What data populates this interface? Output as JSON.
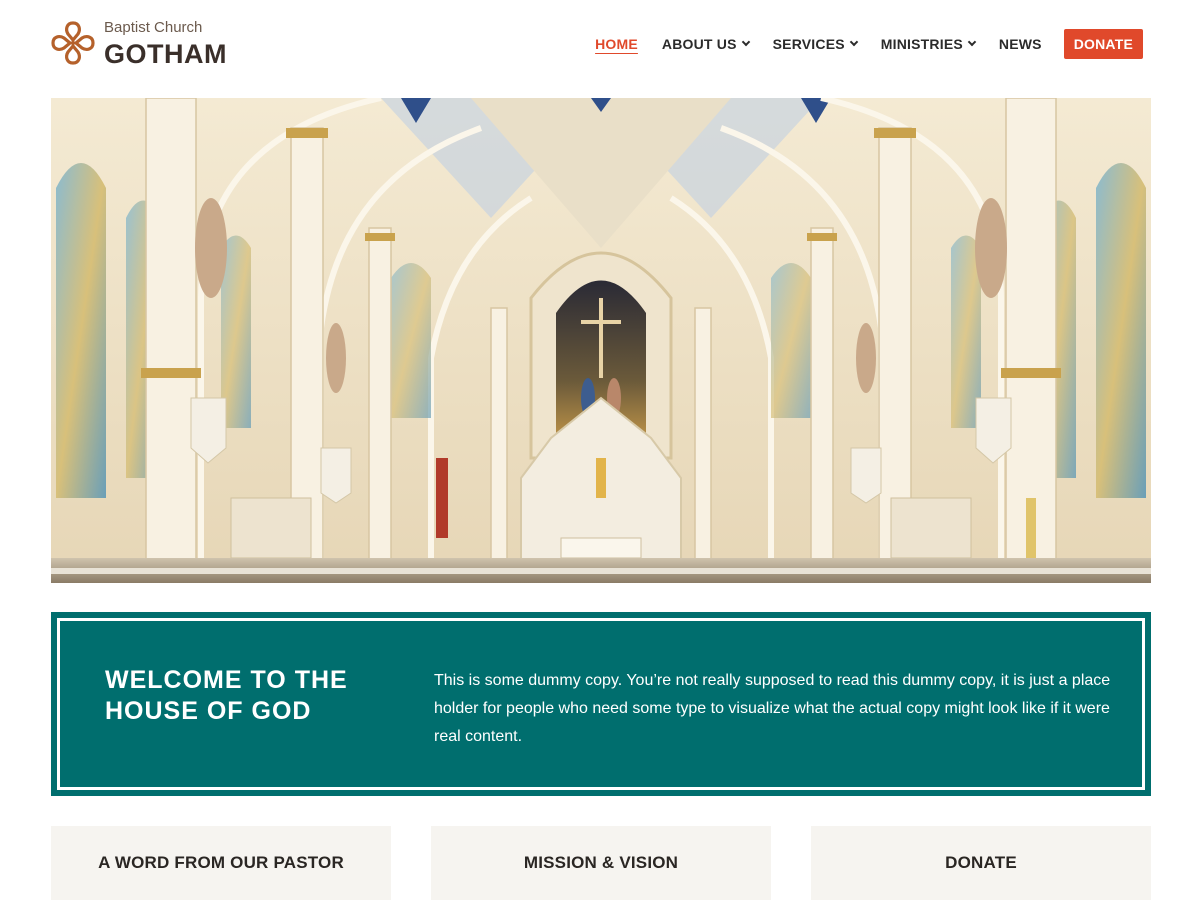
{
  "brand": {
    "subtitle": "Baptist Church",
    "name": "GOTHAM",
    "logo_icon": "cross-flower-icon",
    "logo_color": "#b5612b"
  },
  "nav": {
    "items": [
      {
        "label": "HOME",
        "active": true,
        "has_dropdown": false
      },
      {
        "label": "ABOUT US",
        "active": false,
        "has_dropdown": true
      },
      {
        "label": "SERVICES",
        "active": false,
        "has_dropdown": true
      },
      {
        "label": "MINISTRIES",
        "active": false,
        "has_dropdown": true
      },
      {
        "label": "NEWS",
        "active": false,
        "has_dropdown": false
      }
    ],
    "donate_label": "DONATE"
  },
  "hero": {
    "image": "cathedral-interior-altar-image"
  },
  "welcome": {
    "title": "WELCOME TO THE HOUSE OF GOD",
    "body": "This is some dummy copy. You’re not really supposed to read this dummy copy, it is just a place holder for people who need some type to visualize what the actual copy might look like if it were real content."
  },
  "cards": [
    {
      "label": "A WORD FROM OUR PASTOR"
    },
    {
      "label": "MISSION & VISION"
    },
    {
      "label": "DONATE"
    }
  ],
  "colors": {
    "accent": "#e0492b",
    "teal": "#006e6e",
    "card_bg": "#f6f4f0",
    "text_dark": "#2b2b2b"
  }
}
